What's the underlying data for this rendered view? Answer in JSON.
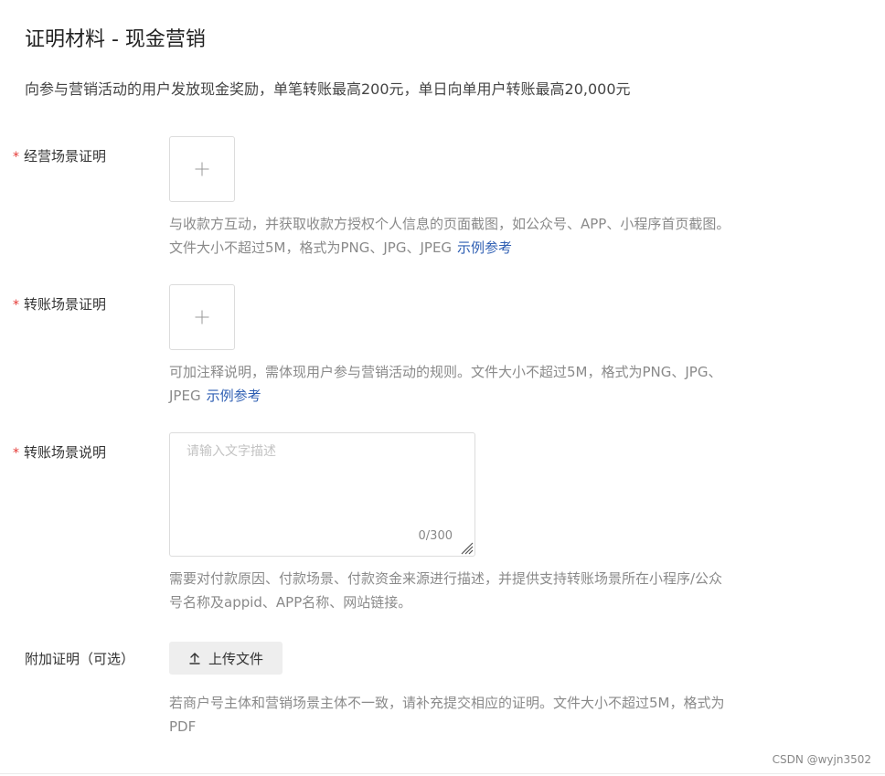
{
  "header": {
    "title": "证明材料 - 现金营销",
    "subtitle": "向参与营销活动的用户发放现金奖励，单笔转账最高200元，单日向单用户转账最高20,000元"
  },
  "required_mark": "*",
  "fields": {
    "business_scene": {
      "label": "经营场景证明",
      "hint": "与收款方互动，并获取收款方授权个人信息的页面截图，如公众号、APP、小程序首页截图。文件大小不超过5M，格式为PNG、JPG、JPEG",
      "link": "示例参考"
    },
    "transfer_scene": {
      "label": "转账场景证明",
      "hint": "可加注释说明，需体现用户参与营销活动的规则。文件大小不超过5M，格式为PNG、JPG、JPEG",
      "link": "示例参考"
    },
    "transfer_desc": {
      "label": "转账场景说明",
      "placeholder": "请输入文字描述",
      "counter": "0/300",
      "hint": "需要对付款原因、付款场景、付款资金来源进行描述，并提供支持转账场景所在小程序/公众号名称及appid、APP名称、网站链接。"
    },
    "extra_proof": {
      "label": "附加证明（可选）",
      "button_label": "上传文件",
      "hint": "若商户号主体和营销场景主体不一致，请补充提交相应的证明。文件大小不超过5M，格式为PDF"
    }
  },
  "watermark": "CSDN @wyjn3502",
  "colors": {
    "required": "#e53935",
    "link": "#2f5fb3",
    "hint": "#8a8a8a"
  },
  "icons": {
    "upload_plus": "plus-icon",
    "upload_button": "upload-arrow-icon",
    "resize": "resize-handle-icon"
  }
}
